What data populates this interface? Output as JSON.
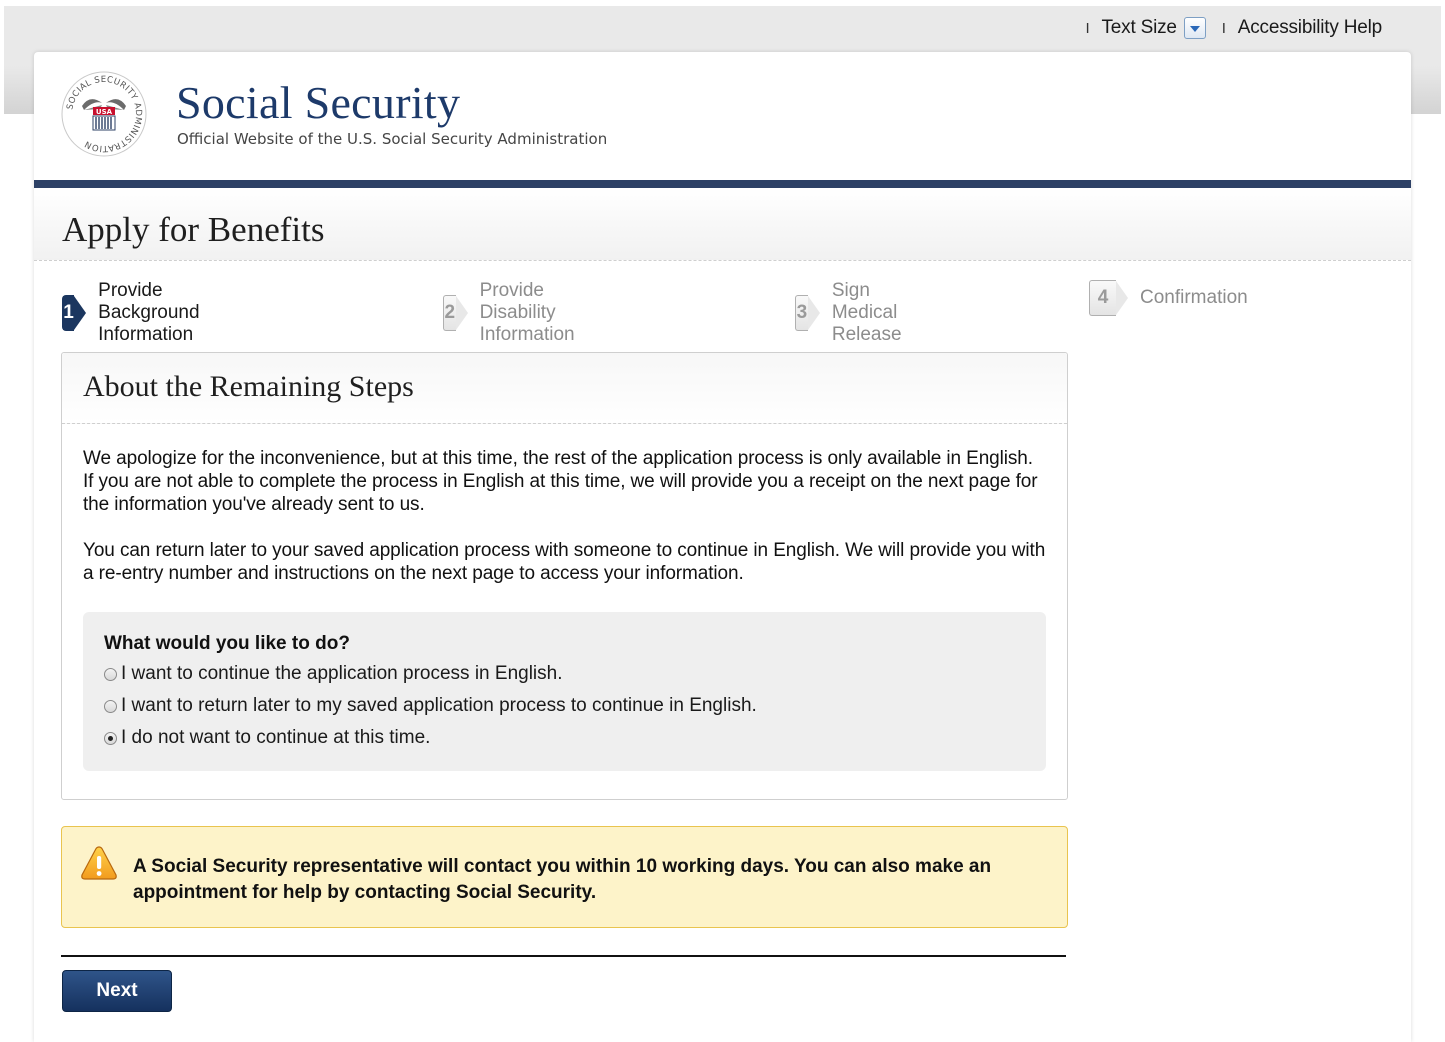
{
  "utility": {
    "sep": "I",
    "text_size": "Text Size",
    "accessibility_help": "Accessibility Help"
  },
  "header": {
    "brand_title": "Social Security",
    "brand_subtitle": "Official Website of the U.S. Social Security Administration",
    "seal_text": "SOCIAL SECURITY ADMINISTRATION",
    "seal_usa": "USA"
  },
  "page": {
    "title": "Apply for Benefits"
  },
  "steps": [
    {
      "num": "1",
      "label": "Provide Background Information",
      "state": "active"
    },
    {
      "num": "2",
      "label": "Provide Disability Information",
      "state": "inactive"
    },
    {
      "num": "3",
      "label": "Sign Medical Release",
      "state": "inactive"
    },
    {
      "num": "4",
      "label": "Confirmation",
      "state": "inactive"
    }
  ],
  "panel": {
    "title": "About the Remaining Steps",
    "para1": "We apologize for the inconvenience, but at this time, the rest of the application process is only available in English. If you are not able to complete the process in English at this time, we will provide you a receipt on the next page for the information you've already sent to us.",
    "para2": "You can return later to your saved application process with someone to continue in English. We will provide you with a re-entry number and instructions on the next page to access your information.",
    "question": "What would you like to do?",
    "options": [
      {
        "label": "I want to continue the application process in English.",
        "selected": false
      },
      {
        "label": "I want to return later to my saved application process to continue in English.",
        "selected": false
      },
      {
        "label": "I do not want to continue at this time.",
        "selected": true
      }
    ]
  },
  "alert": {
    "icon": "warning-icon",
    "text": "A Social Security representative will contact you within 10 working days. You can also make an appointment for help by contacting Social Security."
  },
  "actions": {
    "next_label": "Next"
  },
  "colors": {
    "navy": "#2d4166",
    "brand_text": "#1d3a6a",
    "alert_bg": "#fdf3c9",
    "alert_border": "#e9c44f",
    "button": "#15315e"
  }
}
